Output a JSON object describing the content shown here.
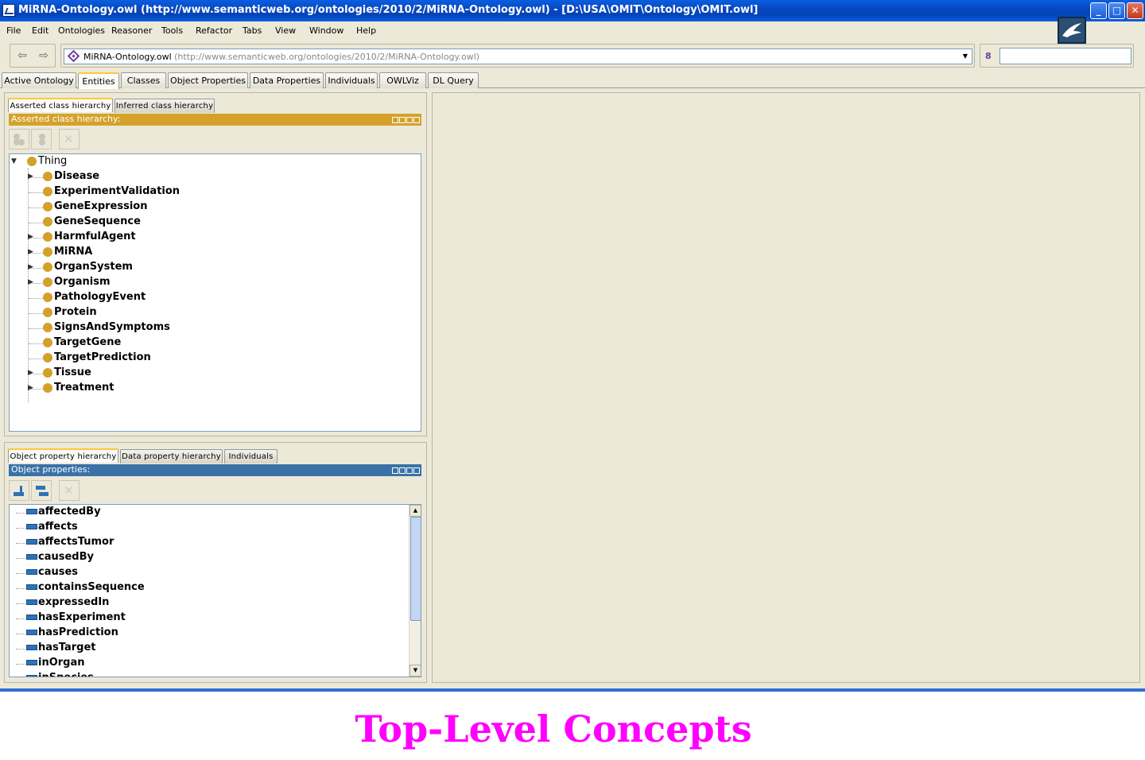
{
  "window": {
    "title": "MiRNA-Ontology.owl (http://www.semanticweb.org/ontologies/2010/2/MiRNA-Ontology.owl) - [D:\\USA\\OMIT\\Ontology\\OMIT.owl]",
    "min": "_",
    "max": "□",
    "close": "✕"
  },
  "menu": [
    "File",
    "Edit",
    "Ontologies",
    "Reasoner",
    "Tools",
    "Refactor",
    "Tabs",
    "View",
    "Window",
    "Help"
  ],
  "toolbar": {
    "back": "⇦",
    "forward": "⇨",
    "ontology_name": "MiRNA-Ontology.owl",
    "ontology_uri": "(http://www.semanticweb.org/ontologies/2010/2/MiRNA-Ontology.owl)",
    "search_value": "",
    "search_icon_glyph": "8"
  },
  "main_tabs": [
    "Active Ontology",
    "Entities",
    "Classes",
    "Object Properties",
    "Data Properties",
    "Individuals",
    "OWLViz",
    "DL Query"
  ],
  "main_tabs_active": "Entities",
  "class_panel": {
    "tabs": [
      "Asserted class hierarchy",
      "Inferred class hierarchy"
    ],
    "header": "Asserted class hierarchy:",
    "header_color": "#d4a22b",
    "root": "Thing",
    "classes": [
      {
        "name": "Disease",
        "expandable": true
      },
      {
        "name": "ExperimentValidation",
        "expandable": false
      },
      {
        "name": "GeneExpression",
        "expandable": false
      },
      {
        "name": "GeneSequence",
        "expandable": false
      },
      {
        "name": "HarmfulAgent",
        "expandable": true
      },
      {
        "name": "MiRNA",
        "expandable": true
      },
      {
        "name": "OrganSystem",
        "expandable": true
      },
      {
        "name": "Organism",
        "expandable": true
      },
      {
        "name": "PathologyEvent",
        "expandable": false
      },
      {
        "name": "Protein",
        "expandable": false
      },
      {
        "name": "SignsAndSymptoms",
        "expandable": false
      },
      {
        "name": "TargetGene",
        "expandable": false
      },
      {
        "name": "TargetPrediction",
        "expandable": false
      },
      {
        "name": "Tissue",
        "expandable": true
      },
      {
        "name": "Treatment",
        "expandable": true
      }
    ]
  },
  "property_panel": {
    "tabs": [
      "Object property hierarchy",
      "Data property hierarchy",
      "Individuals"
    ],
    "header": "Object properties:",
    "header_color": "#3a72a8",
    "properties": [
      "affectedBy",
      "affects",
      "affectsTumor",
      "causedBy",
      "causes",
      "containsSequence",
      "expressedIn",
      "hasExperiment",
      "hasPrediction",
      "hasTarget",
      "inOrgan",
      "inSpecies"
    ]
  },
  "caption": "Top-Level Concepts"
}
